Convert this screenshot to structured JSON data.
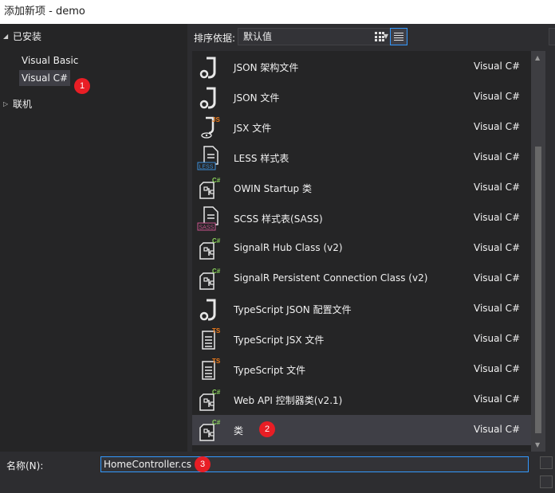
{
  "window": {
    "title": "添加新项 - demo"
  },
  "tree": {
    "installed_label": "已安装",
    "installed_arrow": "◢",
    "children": [
      {
        "label": "Visual Basic"
      },
      {
        "label": "Visual C#"
      }
    ],
    "online_label": "联机",
    "online_arrow": "▷"
  },
  "sort": {
    "label": "排序依据:",
    "value": "默认值",
    "arrow": "▼"
  },
  "templates": [
    {
      "name": "JSON 架构文件",
      "lang": "Visual C#",
      "icon": "json-schema-icon"
    },
    {
      "name": "JSON 文件",
      "lang": "Visual C#",
      "icon": "json-file-icon"
    },
    {
      "name": "JSX 文件",
      "lang": "Visual C#",
      "icon": "jsx-file-icon",
      "tag": "JS"
    },
    {
      "name": "LESS 样式表",
      "lang": "Visual C#",
      "icon": "less-stylesheet-icon",
      "tag": "LESS"
    },
    {
      "name": "OWIN Startup 类",
      "lang": "Visual C#",
      "icon": "csharp-class-icon",
      "tag": "C#"
    },
    {
      "name": "SCSS 样式表(SASS)",
      "lang": "Visual C#",
      "icon": "scss-stylesheet-icon",
      "tag": "SASS"
    },
    {
      "name": "SignalR Hub Class (v2)",
      "lang": "Visual C#",
      "icon": "csharp-class-icon",
      "tag": "C#"
    },
    {
      "name": "SignalR Persistent Connection Class (v2)",
      "lang": "Visual C#",
      "icon": "csharp-class-icon",
      "tag": "C#"
    },
    {
      "name": "TypeScript JSON 配置文件",
      "lang": "Visual C#",
      "icon": "json-config-icon"
    },
    {
      "name": "TypeScript JSX 文件",
      "lang": "Visual C#",
      "icon": "tsx-file-icon",
      "tag": "TS"
    },
    {
      "name": "TypeScript 文件",
      "lang": "Visual C#",
      "icon": "ts-file-icon",
      "tag": "TS"
    },
    {
      "name": "Web API 控制器类(v2.1)",
      "lang": "Visual C#",
      "icon": "csharp-class-icon",
      "tag": "C#"
    },
    {
      "name": "类",
      "lang": "Visual C#",
      "icon": "csharp-class-icon",
      "tag": "C#"
    }
  ],
  "scrollbar": {
    "up": "▲",
    "down": "▼"
  },
  "name_field": {
    "label": "名称(N):",
    "value": "HomeController.cs"
  },
  "annotations": [
    "1",
    "2",
    "3"
  ],
  "colors": {
    "accent": "#3399ff",
    "badge": "#e81e25",
    "csharp_tag": "#8bd35c",
    "js_tag": "#f07c1b",
    "less_tag": "#3b8fd9",
    "sass_tag": "#c6538c"
  }
}
